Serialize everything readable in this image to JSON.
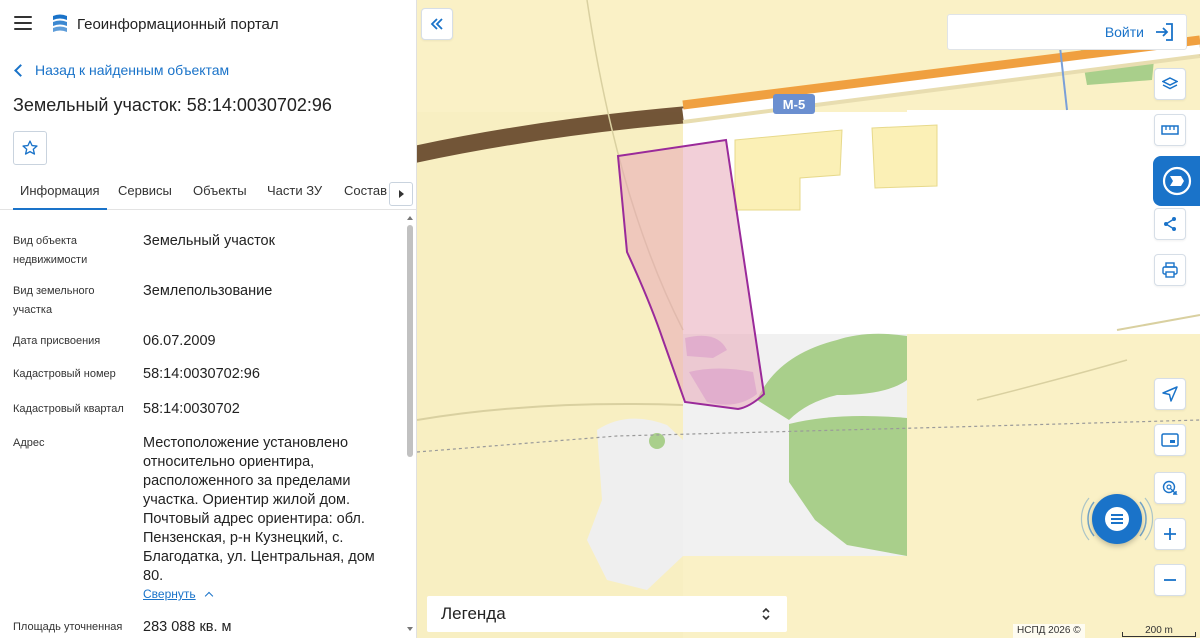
{
  "header": {
    "app_title": "Геоинформационный портал",
    "menu_icon": "hamburger-icon",
    "logo_icon": "portal-logo"
  },
  "back_link": "Назад к найденным объектам",
  "parcel_title": "Земельный участок: 58:14:0030702:96",
  "tabs": [
    {
      "label": "Информация",
      "active": true
    },
    {
      "label": "Сервисы"
    },
    {
      "label": "Объекты"
    },
    {
      "label": "Части ЗУ"
    },
    {
      "label": "Состав"
    }
  ],
  "properties": [
    {
      "label": "Вид объекта недвижимости",
      "value": "Земельный участок"
    },
    {
      "label": "Вид земельного участка",
      "value": "Землепользование"
    },
    {
      "label": "Дата присвоения",
      "value": "06.07.2009"
    },
    {
      "label": "Кадастровый номер",
      "value": "58:14:0030702:96"
    },
    {
      "label": "Кадастровый квартал",
      "value": "58:14:0030702"
    },
    {
      "label": "Адрес",
      "value": "Местоположение установлено относительно ориентира, расположенного за пределами участка. Ориентир жилой дом. Почтовый адрес ориентира: обл. Пензенская, р-н Кузнецкий, с. Благодатка, ул. Центральная, дом 80."
    },
    {
      "label": "Площадь уточненная",
      "value": "283 088 кв. м"
    }
  ],
  "collapse_label": "Свернуть",
  "map": {
    "login_label": "Войти",
    "road_label": "М-5",
    "legend_label": "Легенда",
    "attribution": "НСПД 2026 ©",
    "scale_label": "200 m",
    "colors": {
      "parcel_fill": "#e8a7b8",
      "parcel_stroke": "#9a2a9a",
      "accent": "#1a73c9",
      "road": "#f0a040"
    }
  }
}
